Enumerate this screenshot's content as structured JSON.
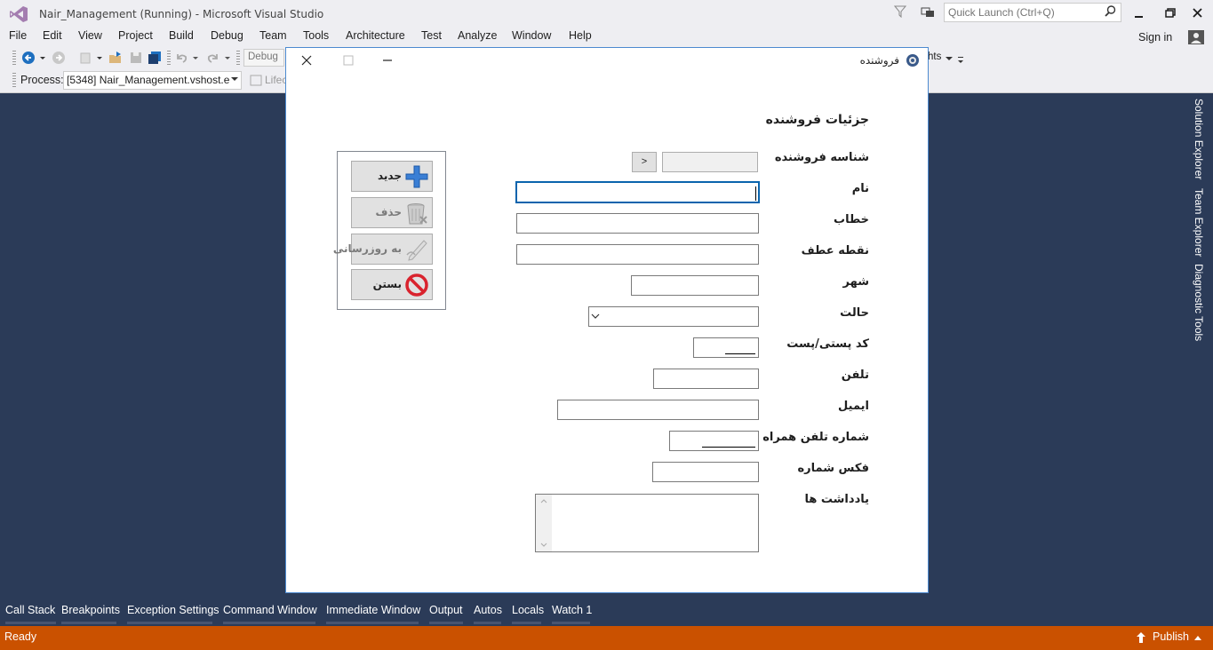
{
  "vs": {
    "title": "Nair_Management (Running) - Microsoft Visual Studio",
    "quick_launch_placeholder": "Quick Launch (Ctrl+Q)",
    "menu": [
      "File",
      "Edit",
      "View",
      "Project",
      "Build",
      "Debug",
      "Team",
      "Tools",
      "Architecture",
      "Test",
      "Analyze",
      "Window",
      "Help"
    ],
    "sign_in": "Sign in",
    "toolbar": {
      "config": "Debug",
      "insights": "hts",
      "process_label": "Process:",
      "process_value": "[5348] Nair_Management.vshost.e",
      "lifecycle": "Lifec"
    },
    "right_tabs": [
      "Solution Explorer",
      "Team Explorer",
      "Diagnostic Tools"
    ],
    "bottom_tabs": [
      "Call Stack",
      "Breakpoints",
      "Exception Settings",
      "Command Window",
      "Immediate Window",
      "Output",
      "Autos",
      "Locals",
      "Watch 1"
    ],
    "status": "Ready",
    "publish": "Publish",
    "colors": {
      "status_bar": "#ca5100",
      "background": "#2b3b58",
      "chrome": "#eeeef2",
      "dialog_border": "#4c8ad0"
    }
  },
  "dialog": {
    "title": "فروشنده",
    "section_title": "جزئیات فروشنده",
    "nav_button": ">",
    "fields": {
      "seller_id": "شناسه فروشنده",
      "name": "نام",
      "title": "خطاب",
      "attention": "نقطه عطف",
      "city": "شهر",
      "state": "حالت",
      "postal_code": "کد پستی/پست",
      "phone": "تلفن",
      "email": "ایمیل",
      "mobile": "شماره تلفن همراه",
      "fax": "فکس شماره",
      "notes": "یادداشت ها"
    },
    "actions": {
      "new": "جدید",
      "delete": "حذف",
      "update": "به روزرسانی",
      "close": "بستن"
    }
  }
}
